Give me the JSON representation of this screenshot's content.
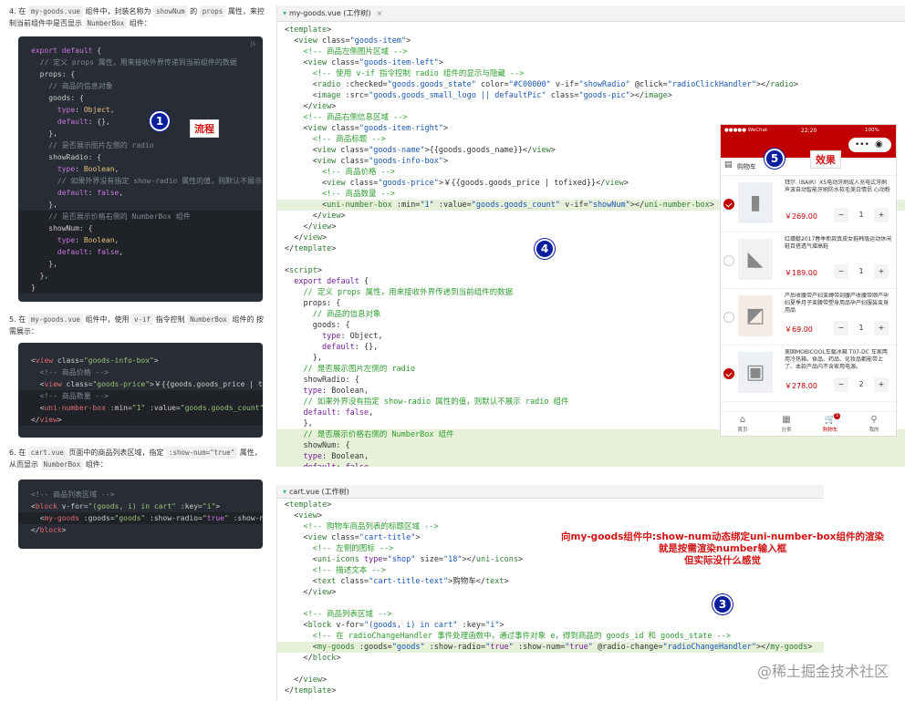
{
  "doc": {
    "step4": {
      "n": "4.",
      "pre": "在",
      "file": "my-goods.vue",
      "mid": "组件中，封装名称为",
      "prop": "showNum",
      "mid2": "的",
      "props": "props",
      "post": "属性，来控制当前组件中是否显示",
      "nb": "NumberBox",
      "end": "组件："
    },
    "step5": {
      "n": "5.",
      "pre": "在",
      "file": "my-goods.vue",
      "mid": "组件中，使用",
      "vif": "v-if",
      "mid2": "指令控制",
      "nb": "NumberBox",
      "post": "组件的",
      "end": "按需展示："
    },
    "step6": {
      "n": "6.",
      "pre": "在",
      "file": "cart.vue",
      "mid": "页面中的商品列表区域，指定",
      "attr": ":show-num=\"true\"",
      "post": "属性，",
      "line2": "从而显示",
      "nb": "NumberBox",
      "end": "组件："
    },
    "code1": [
      "export default {",
      "  // 定义 props 属性，用来接收外界传递到当前组件的数据",
      "  props: {",
      "    // 商品的信息对象",
      "    goods: {",
      "      type: Object,",
      "      default: {},",
      "    },",
      "    // 是否展示图片左侧的 radio",
      "    showRadio: {",
      "      type: Boolean,",
      "      // 如果外界没有指定 show-radio 属性的值，则默认不展示",
      "      default: false,",
      "    },",
      "    // 是否展示价格右侧的 NumberBox 组件",
      "    showNum: {",
      "      type: Boolean,",
      "      default: false,",
      "    },",
      "  },",
      "}"
    ],
    "code2": [
      "<view class=\"goods-info-box\">",
      "  <!-- 商品价格 -->",
      "  <view class=\"goods-price\">￥{{goods.goods_price | to",
      "  <!-- 商品数量 -->",
      "  <uni-number-box :min=\"1\" :value=\"goods.goods_count\"",
      "</view>"
    ],
    "code3": [
      "<!-- 商品列表区域 -->",
      "<block v-for=\"(goods, i) in cart\" :key=\"i\">",
      "  <my-goods :goods=\"goods\" :show-radio=\"true\" :show-nu",
      "</block>"
    ],
    "js_tag": "js"
  },
  "editor_top": {
    "tab": "my-goods.vue (工作树)",
    "lines": [
      "<template>",
      "  <view class=\"goods-item\">",
      "    <!-- 商品左侧图片区域 -->",
      "    <view class=\"goods-item-left\">",
      "      <!-- 使用 v-if 指令控制 radio 组件的显示与隐藏 -->",
      "      <radio :checked=\"goods.goods_state\" color=\"#C00000\" v-if=\"showRadio\" @click=\"radioClickHandler\"></radio>",
      "      <image :src=\"goods.goods_small_logo || defaultPic\" class=\"goods-pic\"></image>",
      "    </view>",
      "    <!-- 商品右侧信息区域 -->",
      "    <view class=\"goods-item-right\">",
      "      <!-- 商品标题 -->",
      "      <view class=\"goods-name\">{{goods.goods_name}}</view>",
      "      <view class=\"goods-info-box\">",
      "        <!-- 商品价格 -->",
      "        <view class=\"goods-price\">￥{{goods.goods_price | tofixed}}</view>",
      "        <!-- 商品数量 -->",
      "        <uni-number-box :min=\"1\" :value=\"goods.goods_count\" v-if=\"showNum\"></uni-number-box>",
      "      </view>",
      "    </view>",
      "  </view>",
      "</template>",
      "",
      "<script>",
      "  export default {",
      "    // 定义 props 属性，用来接收外界传递到当前组件的数据",
      "    props: {",
      "      // 商品的信息对象",
      "      goods: {",
      "        type: Object,",
      "        default: {},",
      "      },",
      "    // 是否展示图片左侧的 radio",
      "    showRadio: {",
      "    type: Boolean,",
      "    // 如果外界没有指定 show-radio 属性的值，则默认不展示 radio 组件",
      "    default: false,",
      "    },",
      "    // 是否展示价格右侧的 NumberBox 组件",
      "    showNum: {",
      "    type: Boolean,",
      "    default: false,",
      "    },",
      "    },"
    ]
  },
  "editor_bottom": {
    "tab": "cart.vue (工作树)",
    "lines": [
      "<template>",
      "  <view>",
      "    <!-- 购物车商品列表的标题区域 -->",
      "    <view class=\"cart-title\">",
      "      <!-- 左侧的图标 -->",
      "      <uni-icons type=\"shop\" size=\"18\"></uni-icons>",
      "      <!-- 描述文本 -->",
      "      <text class=\"cart-title-text\">购物车</text>",
      "    </view>",
      "",
      "    <!-- 商品列表区域 -->",
      "    <block v-for=\"(goods, i) in cart\" :key=\"i\">",
      "      <!-- 在 radioChangeHandler 事件处理函数中，通过事件对象 e，得到商品的 goods_id 和 goods_state -->",
      "      <my-goods :goods=\"goods\" :show-radio=\"true\" :show-num=\"true\" @radio-change=\"radioChangeHandler\"></my-goods>",
      "    </block>",
      "",
      "  </view>",
      "</template>"
    ]
  },
  "annotations": {
    "b1": "1",
    "b3": "3",
    "b4": "4",
    "b5": "5",
    "flow": "流程",
    "effect": "效果",
    "note1": "向my-goods组件中:show-num动态绑定uni-number-box组件的渲染",
    "note2": "就是按需渲染number输入框",
    "note3": "但实际没什么感觉",
    "watermark": "@稀土掘金技术社区"
  },
  "phone": {
    "carrier": "●●●●● WeChat",
    "time": "22:20",
    "battery": "100%",
    "cart_title": "购物车",
    "items": [
      {
        "name": "拜尔（BAIR）X5电动牙刷成人充电式牙刷声波自动智能牙刷防水软毛美白情侣 心动粉",
        "price": "￥269.00",
        "qty": "1",
        "checked": true
      },
      {
        "name": "红蜻蜓2017春季新款真皮女鞋韩版运动休闲鞋百搭透气增高鞋",
        "price": "￥189.00",
        "qty": "1",
        "checked": false
      },
      {
        "name": "产后收腹带产妇束缚带剖腹产收腹带顺产孕妇夏季月子束腰带塑身用品孕产妇服装束身用品",
        "price": "￥69.00",
        "qty": "1",
        "checked": false
      },
      {
        "name": "美国MOBICOOL车载冰箱 T07-DC 车家两用冷热箱、食品、药品、化妆品都能带上了、本款产品内不含家用电源。",
        "price": "￥278.00",
        "qty": "2",
        "checked": true
      }
    ],
    "minus": "−",
    "plus": "+",
    "tabs": [
      {
        "icon": "⌂",
        "label": "首页"
      },
      {
        "icon": "▦",
        "label": "分类"
      },
      {
        "icon": "🛒",
        "label": "购物车"
      },
      {
        "icon": "⚲",
        "label": "我的"
      }
    ],
    "cart_badge": "5",
    "colors": {
      "accent": "#C00000"
    }
  }
}
